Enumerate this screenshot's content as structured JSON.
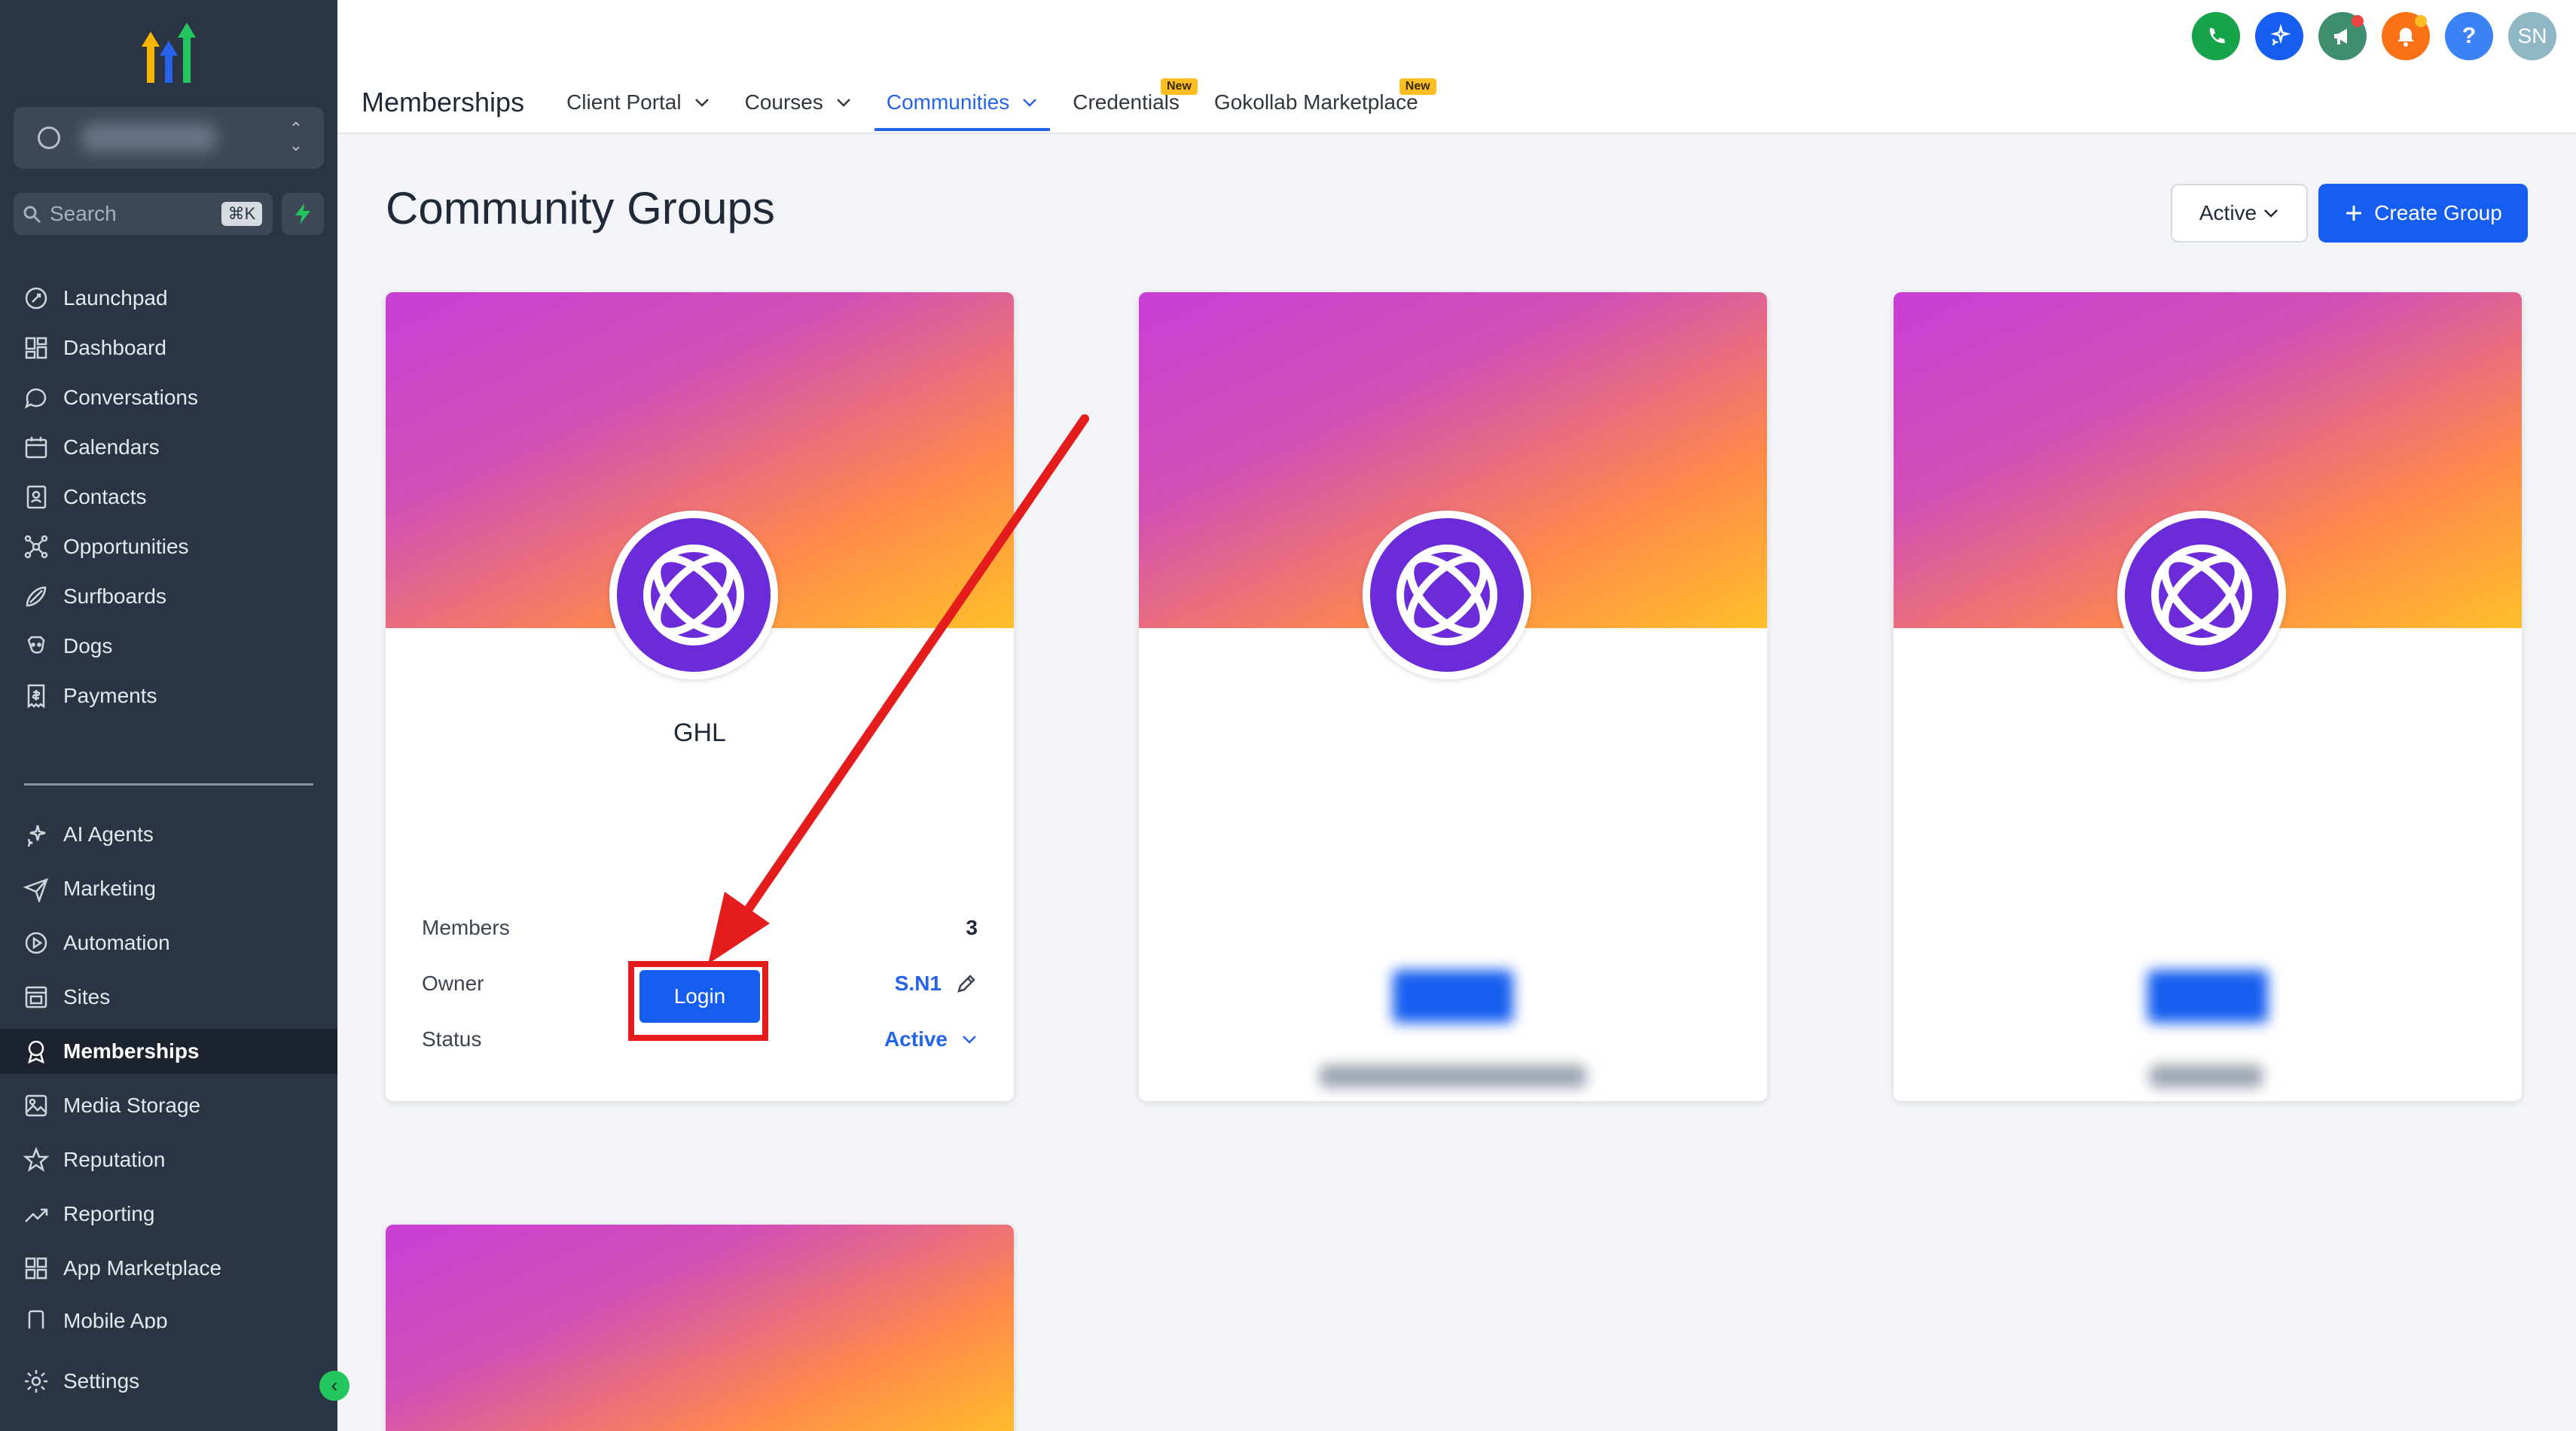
{
  "sidebar": {
    "search": {
      "label": "Search",
      "shortcut": "⌘K"
    },
    "nav_top": [
      {
        "label": "Launchpad",
        "icon": "rocket-icon"
      },
      {
        "label": "Dashboard",
        "icon": "grid-icon"
      },
      {
        "label": "Conversations",
        "icon": "chat-icon"
      },
      {
        "label": "Calendars",
        "icon": "calendar-icon"
      },
      {
        "label": "Contacts",
        "icon": "contact-book-icon"
      },
      {
        "label": "Opportunities",
        "icon": "network-icon"
      },
      {
        "label": "Surfboards",
        "icon": "surfboard-icon"
      },
      {
        "label": "Dogs",
        "icon": "dog-icon"
      },
      {
        "label": "Payments",
        "icon": "receipt-icon"
      }
    ],
    "nav_bottom": [
      {
        "label": "AI Agents",
        "icon": "sparkle-icon"
      },
      {
        "label": "Marketing",
        "icon": "send-icon"
      },
      {
        "label": "Automation",
        "icon": "automation-icon"
      },
      {
        "label": "Sites",
        "icon": "sites-icon"
      },
      {
        "label": "Memberships",
        "icon": "award-icon",
        "active": true
      },
      {
        "label": "Media Storage",
        "icon": "image-icon"
      },
      {
        "label": "Reputation",
        "icon": "star-icon"
      },
      {
        "label": "Reporting",
        "icon": "trend-icon"
      },
      {
        "label": "App Marketplace",
        "icon": "apps-icon"
      },
      {
        "label": "Mobile App",
        "icon": "phone-icon"
      }
    ],
    "settings": {
      "label": "Settings",
      "icon": "gear-icon"
    }
  },
  "topbar": {
    "brand": "Memberships",
    "tabs": [
      {
        "label": "Client Portal",
        "dropdown": true
      },
      {
        "label": "Courses",
        "dropdown": true
      },
      {
        "label": "Communities",
        "dropdown": true,
        "active": true
      },
      {
        "label": "Credentials",
        "badge": "New"
      },
      {
        "label": "Gokollab Marketplace",
        "badge": "New"
      }
    ],
    "icons": [
      {
        "name": "phone-icon",
        "color": "#16a34a"
      },
      {
        "name": "ai-sparkle-icon",
        "color": "#155eef"
      },
      {
        "name": "megaphone-icon",
        "color": "#3f8f6f",
        "dot": "#ef4444"
      },
      {
        "name": "bell-icon",
        "color": "#f97316",
        "dot": "#fbbf24"
      },
      {
        "name": "help-icon",
        "color": "#3b82f6",
        "text": "?"
      },
      {
        "name": "user-avatar",
        "color": "#8fb8c4",
        "text": "SN"
      }
    ]
  },
  "main": {
    "heading": "Community Groups",
    "filter_value": "Active",
    "create_label": "Create Group",
    "groups": [
      {
        "name": "GHL",
        "members_label": "Members",
        "members": "3",
        "owner_label": "Owner",
        "owner": "S.N1",
        "status_label": "Status",
        "status": "Active",
        "login_label": "Login"
      }
    ]
  },
  "colors": {
    "sidebar_bg": "#2b3442",
    "accent": "#155eef",
    "annotation": "#e51c1c",
    "community_logo": "#6c2bd9"
  }
}
